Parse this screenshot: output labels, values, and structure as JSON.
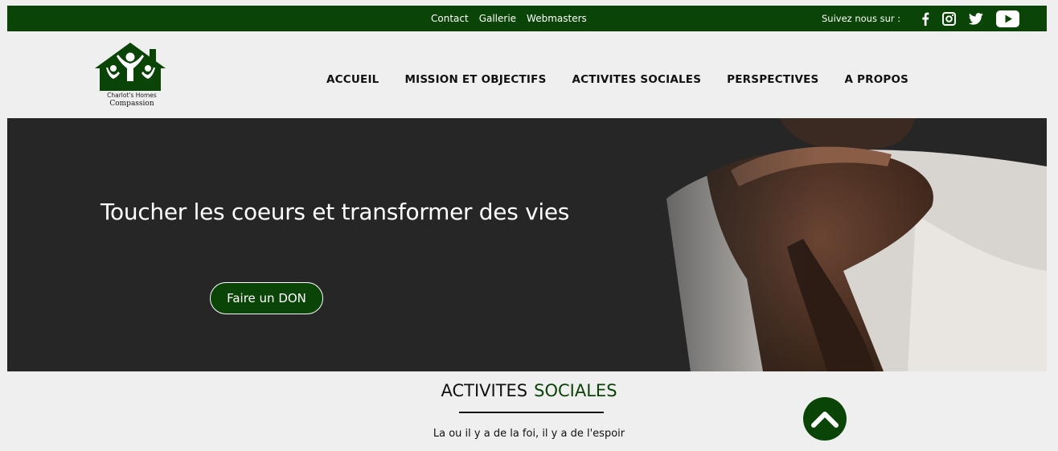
{
  "topbar": {
    "links": [
      "Contact",
      "Gallerie",
      "Webmasters"
    ],
    "follow_label": "Suivez nous sur :",
    "social": [
      "facebook-icon",
      "instagram-icon",
      "twitter-icon",
      "youtube-icon"
    ]
  },
  "logo": {
    "line1": "Charlot's Homes",
    "line2": "Compassion"
  },
  "nav": [
    "ACCUEIL",
    "MISSION ET OBJECTIFS",
    "ACTIVITES SOCIALES",
    "PERSPECTIVES",
    "A PROPOS"
  ],
  "hero": {
    "headline": "Toucher les coeurs et transformer des vies",
    "cta": "Faire un DON"
  },
  "section": {
    "title_main": "ACTIVITES",
    "title_accent": "SOCIALES",
    "tagline": "La ou il y a de la foi, il y a de l'espoir"
  },
  "colors": {
    "brand_green": "#0a4406",
    "background": "#efefef"
  }
}
